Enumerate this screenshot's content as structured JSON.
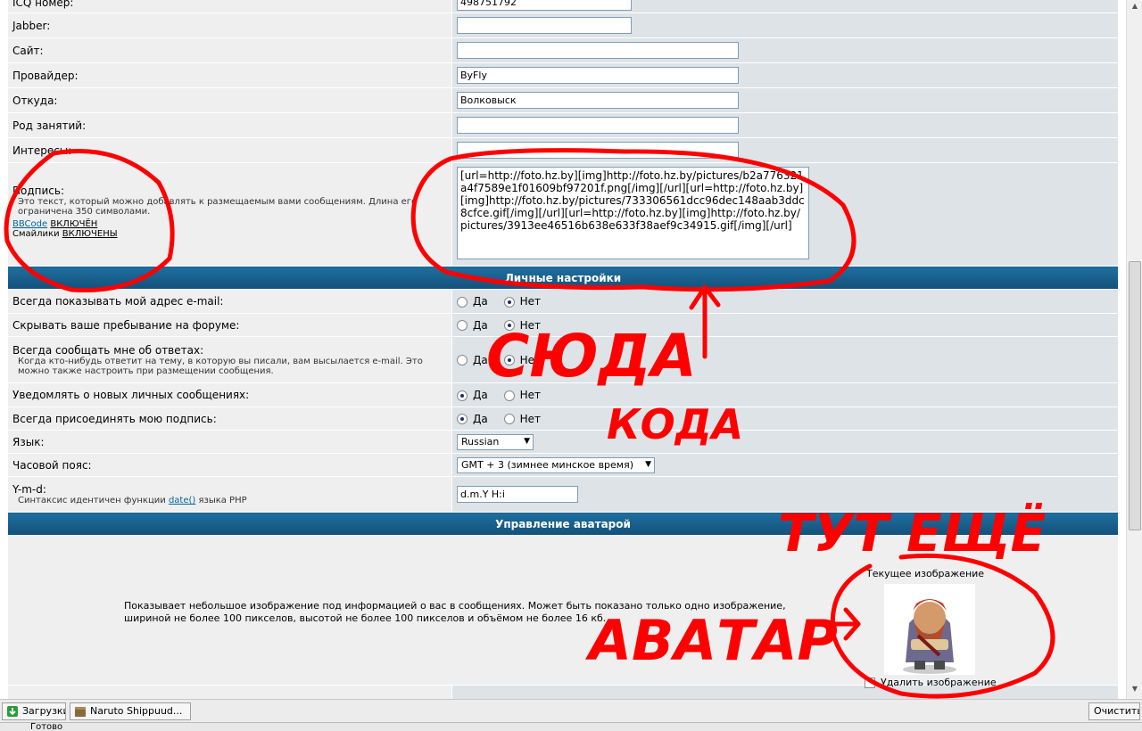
{
  "form": {
    "icq_label": "ICQ номер:",
    "icq_value": "498751792",
    "jabber_label": "Jabber:",
    "jabber_value": "",
    "site_label": "Сайт:",
    "site_value": "",
    "provider_label": "Провайдер:",
    "provider_value": "ByFly",
    "from_label": "Откуда:",
    "from_value": "Волковыск",
    "occupation_label": "Род занятий:",
    "occupation_value": "",
    "interests_label": "Интересы:",
    "interests_value": "",
    "signature_label": "Подпись:",
    "signature_hint": "Это текст, который можно добавлять к размещаемым вами сообщениям. Длина его ограничена 350 символами.",
    "bbcode_link": "BBCode",
    "bbcode_state": "ВКЛЮЧЁН",
    "smilies_label": "Смайлики",
    "smilies_state": "ВКЛЮЧЕНЫ",
    "signature_value": "[url=http://foto.hz.by][img]http://foto.hz.by/pictures/b2a776321a4f7589e1f01609bf97201f.png[/img][/url][url=http://foto.hz.by][img]http://foto.hz.by/pictures/733306561dcc96dec148aab3ddc8cfce.gif[/img][/url][url=http://foto.hz.by][img]http://foto.hz.by/pictures/3913ee46516b638e633f38aef9c34915.gif[/img][/url]"
  },
  "prefs": {
    "section_title": "Личные настройки",
    "yes": "Да",
    "no": "Нет",
    "show_email_label": "Всегда показывать мой адрес e-mail:",
    "hide_online_label": "Скрывать ваше пребывание на форуме:",
    "notify_replies_label": "Всегда сообщать мне об ответах:",
    "notify_replies_hint": "Когда кто-нибудь ответит на тему, в которую вы писали, вам высылается e-mail. Это можно также настроить при размещении сообщения.",
    "notify_pm_label": "Уведомлять о новых личных сообщениях:",
    "attach_sig_label": "Всегда присоединять мою подпись:",
    "language_label": "Язык:",
    "language_value": "Russian",
    "timezone_label": "Часовой пояс:",
    "timezone_value": "GMT + 3 (зимнее минское время)",
    "date_label": "Y-m-d:",
    "date_hint_pre": "Синтаксис идентичен функции",
    "date_hint_link": "date()",
    "date_hint_post": "языка PHP",
    "date_value": "d.m.Y H:i"
  },
  "avatar": {
    "section_title": "Управление аватарой",
    "description": "Показывает небольшое изображение под информацией о вас в сообщениях. Может быть показано только одно изображение, шириной не более 100 пикселов, высотой не более 100 пикселов и объёмом не более 16 кб.",
    "current_label": "Текущее изображение",
    "delete_label": "Удалить изображение"
  },
  "annotations": {
    "sign_1": "СЮДА",
    "sign_2": "КОДА",
    "sign_3": "ТУТ ЕЩЁ",
    "sign_4": "АВАТАР"
  },
  "taskbar": {
    "downloads": "Загрузки",
    "window": "Naruto Shippuud...",
    "clear": "Очистить"
  },
  "status": {
    "text": "Готово"
  },
  "colors": {
    "section_bar": "#1e6fa0",
    "label_bg": "#efefef",
    "value_bg": "#dee3e7",
    "ink": "#ff0000"
  }
}
